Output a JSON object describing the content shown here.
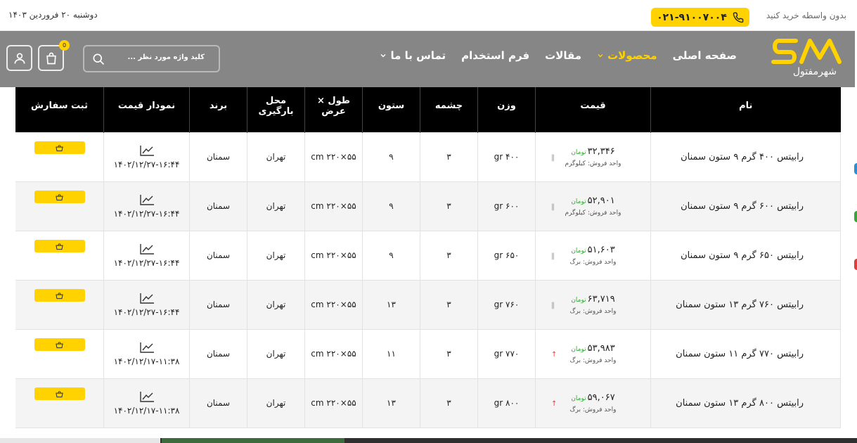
{
  "topbar": {
    "tagline": "بدون واسطه خرید کنید",
    "phone": "۰۲۱-۹۱۰۰۷۰۰۴",
    "date": "دوشنبه ۲۰ فروردین ۱۴۰۳"
  },
  "header": {
    "logo_text": "شهرمفتول",
    "nav": [
      {
        "label": "صفحه اصلی",
        "active": false,
        "dropdown": false
      },
      {
        "label": "محصولات",
        "active": true,
        "dropdown": true
      },
      {
        "label": "مقالات",
        "active": false,
        "dropdown": false
      },
      {
        "label": "فرم استخدام",
        "active": false,
        "dropdown": false
      },
      {
        "label": "تماس با ما",
        "active": false,
        "dropdown": true
      }
    ],
    "search_placeholder": "کلید واژه مورد نظر ...",
    "cart_count": "0"
  },
  "table": {
    "columns": [
      "نام",
      "قیمت",
      "وزن",
      "چشمه",
      "ستون",
      "طول × عرض",
      "محل بارگیری",
      "برند",
      "نمودار قیمت",
      "ثبت سفارش"
    ],
    "currency": "تومان",
    "rows": [
      {
        "name": "رابیتس ۴۰۰ گرم ۹ ستون سمنان",
        "price": "۳۲,۳۴۶",
        "unit": "واحد فروش: کیلوگرم",
        "trend": "flat",
        "weight": "۴۰۰ gr",
        "mesh": "۳",
        "columns": "۹",
        "size": "۵۵×۲۲۰ cm",
        "location": "تهران",
        "brand": "سمنان",
        "chart_date": "۱۴۰۲/۱۲/۲۷-۱۶:۴۴"
      },
      {
        "name": "رابیتس ۶۰۰ گرم ۹ ستون سمنان",
        "price": "۵۲,۹۰۱",
        "unit": "واحد فروش: کیلوگرم",
        "trend": "flat",
        "weight": "۶۰۰ gr",
        "mesh": "۳",
        "columns": "۹",
        "size": "۵۵×۲۲۰ cm",
        "location": "تهران",
        "brand": "سمنان",
        "chart_date": "۱۴۰۲/۱۲/۲۷-۱۶:۴۴"
      },
      {
        "name": "رابیتس ۶۵۰ گرم ۹ ستون سمنان",
        "price": "۵۱,۶۰۳",
        "unit": "واحد فروش: برگ",
        "trend": "flat",
        "weight": "۶۵۰ gr",
        "mesh": "۳",
        "columns": "۹",
        "size": "۵۵×۲۲۰ cm",
        "location": "تهران",
        "brand": "سمنان",
        "chart_date": "۱۴۰۲/۱۲/۲۷-۱۶:۴۴"
      },
      {
        "name": "رابیتس ۷۶۰ گرم ۱۳ ستون سمنان",
        "price": "۶۳,۷۱۹",
        "unit": "واحد فروش: برگ",
        "trend": "flat",
        "weight": "۷۶۰ gr",
        "mesh": "۳",
        "columns": "۱۳",
        "size": "۵۵×۲۲۰ cm",
        "location": "تهران",
        "brand": "سمنان",
        "chart_date": "۱۴۰۲/۱۲/۲۷-۱۶:۴۴"
      },
      {
        "name": "رابیتس ۷۷۰ گرم ۱۱ ستون سمنان",
        "price": "۵۳,۹۸۳",
        "unit": "واحد فروش: برگ",
        "trend": "up",
        "weight": "۷۷۰ gr",
        "mesh": "۳",
        "columns": "۱۱",
        "size": "۵۵×۲۲۰ cm",
        "location": "تهران",
        "brand": "سمنان",
        "chart_date": "۱۴۰۲/۱۲/۱۷-۱۱:۳۸"
      },
      {
        "name": "رابیتس ۸۰۰ گرم ۱۳ ستون سمنان",
        "price": "۵۹,۰۶۷",
        "unit": "واحد فروش: برگ",
        "trend": "up",
        "weight": "۸۰۰ gr",
        "mesh": "۳",
        "columns": "۱۳",
        "size": "۵۵×۲۲۰ cm",
        "location": "تهران",
        "brand": "سمنان",
        "chart_date": "۱۴۰۲/۱۲/۱۷-۱۱:۳۸"
      }
    ]
  },
  "colors": {
    "accent": "#ffd200",
    "header_bg": "#868686",
    "table_head_bg": "#000000",
    "currency_green": "#3aa53a",
    "trend_up": "#e23b3b"
  }
}
